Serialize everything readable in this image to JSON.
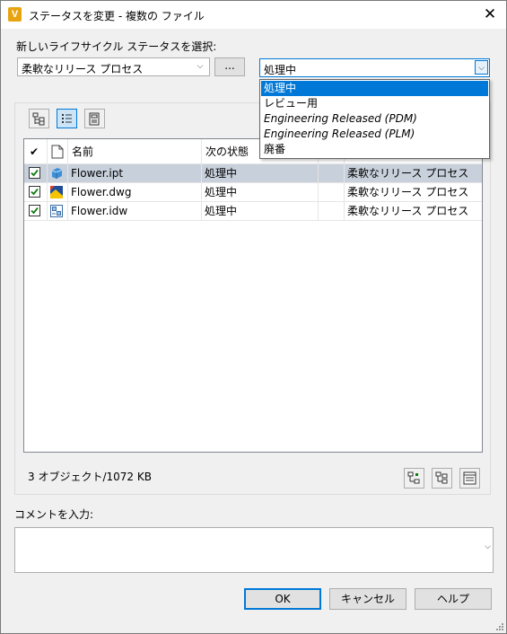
{
  "window": {
    "title": "ステータスを変更 - 複数の ファイル",
    "icon_letter": "V"
  },
  "labels": {
    "select_status": "新しいライフサイクル ステータスを選択:",
    "comment": "コメントを入力:",
    "object_count": "3 オブジェクト/1072 KB"
  },
  "process_combo": {
    "value": "柔軟なリリース プロセス",
    "browse_label": "..."
  },
  "state_combo": {
    "value": "処理中",
    "options": [
      {
        "label": "処理中",
        "highlighted": true,
        "italic": false
      },
      {
        "label": "レビュー用",
        "highlighted": false,
        "italic": false
      },
      {
        "label": "Engineering Released (PDM)",
        "highlighted": false,
        "italic": true
      },
      {
        "label": "Engineering Released (PLM)",
        "highlighted": false,
        "italic": true
      },
      {
        "label": "廃番",
        "highlighted": false,
        "italic": false
      }
    ]
  },
  "toolbar": {
    "icons": [
      "tree-view-icon",
      "list-view-icon",
      "detail-view-icon"
    ],
    "selected": "list-view-icon"
  },
  "table": {
    "headers": {
      "check": "✔",
      "name": "名前",
      "next_state": "次の状態",
      "col4": "",
      "process": ""
    },
    "rows": [
      {
        "name": "Flower.ipt",
        "next_state": "処理中",
        "extra": "",
        "process": "柔軟なリリース プロセス",
        "file_icon": "part-file-icon",
        "selected": true
      },
      {
        "name": "Flower.dwg",
        "next_state": "処理中",
        "extra": "",
        "process": "柔軟なリリース プロセス",
        "file_icon": "dwg-file-icon",
        "selected": false
      },
      {
        "name": "Flower.idw",
        "next_state": "処理中",
        "extra": "",
        "process": "柔軟なリリース プロセス",
        "file_icon": "idw-file-icon",
        "selected": false
      }
    ]
  },
  "buttons": {
    "ok": "OK",
    "cancel": "キャンセル",
    "help": "ヘルプ"
  },
  "colors": {
    "accent": "#0078d7",
    "selected_row": "#c8d0dc",
    "app_icon": "#e8a410"
  }
}
